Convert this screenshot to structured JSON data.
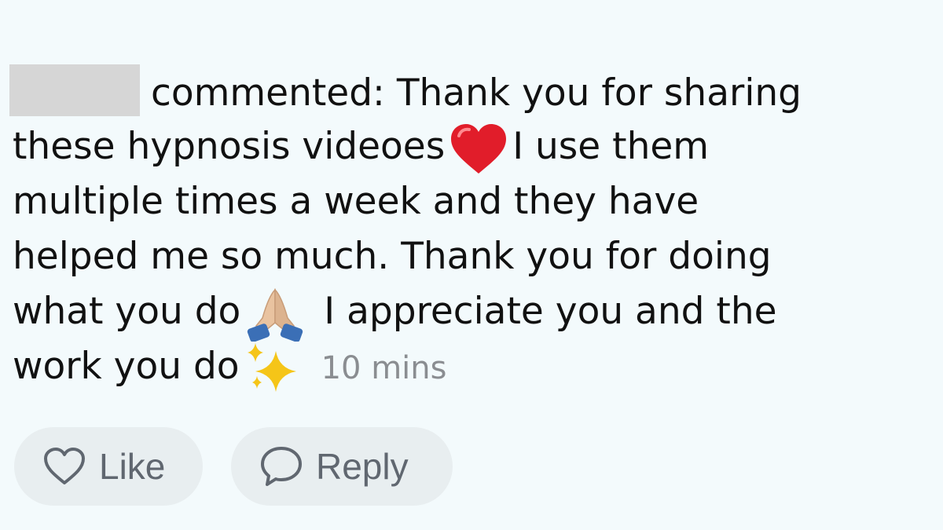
{
  "comment": {
    "author_redacted": true,
    "lines": [
      "commented: Thank you for sharing",
      "these hypnosis videoes",
      "I use them",
      "multiple times a week and they have",
      "helped me so much. Thank you for doing",
      "what you do",
      "I appreciate you and the",
      "work you do"
    ],
    "timestamp": "10 mins"
  },
  "icons": {
    "heart_emoji": "red-heart-emoji",
    "pray_emoji": "folded-hands-emoji",
    "sparkles_emoji": "sparkles-emoji",
    "like": "heart-outline-icon",
    "reply": "speech-bubble-icon"
  },
  "actions": {
    "like_label": "Like",
    "reply_label": "Reply"
  },
  "colors": {
    "background": "#f3fafc",
    "text": "#111111",
    "timestamp": "#8a8d91",
    "pill": "#e8eef0",
    "action_text": "#606770"
  }
}
